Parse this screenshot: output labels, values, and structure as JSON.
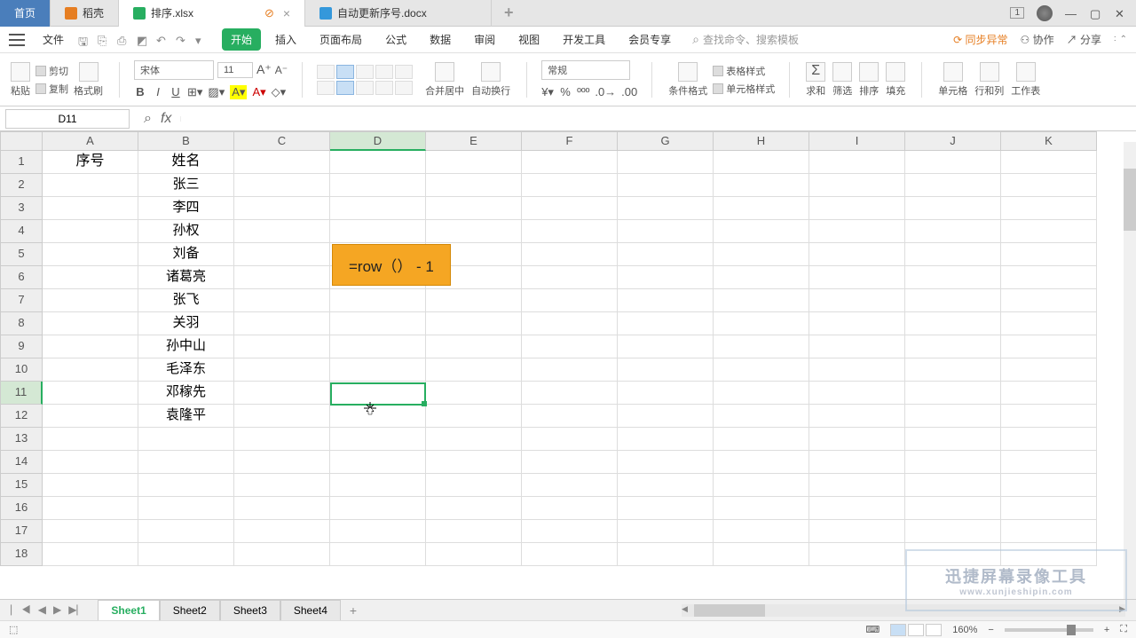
{
  "tabs": {
    "home": "首页",
    "shell": "稻壳",
    "file1": "排序.xlsx",
    "file2": "自动更新序号.docx"
  },
  "menubar": {
    "file": "文件",
    "items": [
      "开始",
      "插入",
      "页面布局",
      "公式",
      "数据",
      "审阅",
      "视图",
      "开发工具",
      "会员专享"
    ],
    "search_placeholder": "查找命令、搜索模板",
    "sync": "同步异常",
    "collab": "协作",
    "share": "分享"
  },
  "ribbon": {
    "paste": "粘贴",
    "cut": "剪切",
    "copy": "复制",
    "format_painter": "格式刷",
    "font": "宋体",
    "font_size": "11",
    "merge": "合并居中",
    "wrap": "自动换行",
    "number_format": "常规",
    "cond_format": "条件格式",
    "table_style": "表格样式",
    "cell_style": "单元格样式",
    "sum": "求和",
    "filter": "筛选",
    "sort": "排序",
    "fill": "填充",
    "cell": "单元格",
    "rowcol": "行和列",
    "worksheet": "工作表"
  },
  "formula": {
    "cell_ref": "D11",
    "fx": "fx",
    "content": ""
  },
  "columns": [
    "A",
    "B",
    "C",
    "D",
    "E",
    "F",
    "G",
    "H",
    "I",
    "J",
    "K"
  ],
  "rows_shown": 18,
  "data": {
    "A1": "序号",
    "B1": "姓名",
    "B2": "张三",
    "B3": "李四",
    "B4": "孙权",
    "B5": "刘备",
    "B6": "诸葛亮",
    "B7": "张飞",
    "B8": "关羽",
    "B9": "孙中山",
    "B10": "毛泽东",
    "B11": "邓稼先",
    "B12": "袁隆平"
  },
  "callout_text": "=row（） - 1",
  "sheets": [
    "Sheet1",
    "Sheet2",
    "Sheet3",
    "Sheet4"
  ],
  "status": {
    "zoom": "160%"
  },
  "watermark": {
    "title": "迅捷屏幕录像工具",
    "url": "www.xunjieshipin.com"
  },
  "win_badge": "1"
}
